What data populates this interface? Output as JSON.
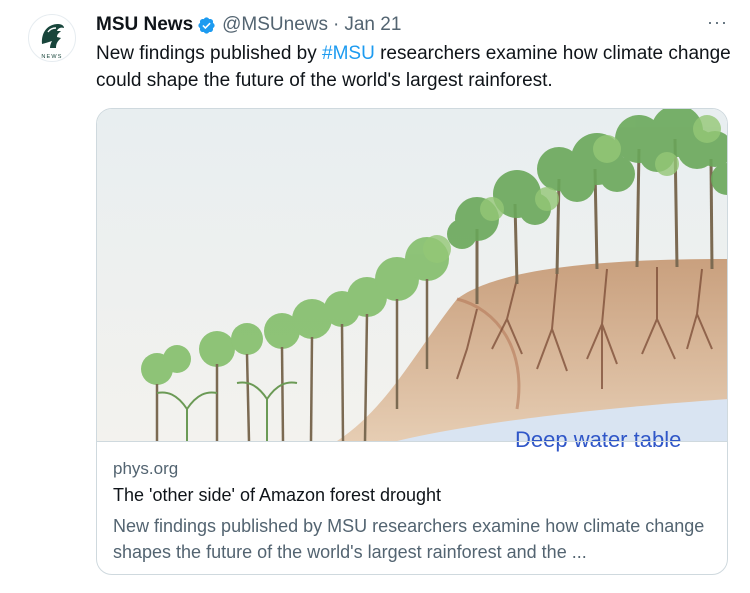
{
  "tweet": {
    "author_name": "MSU News",
    "avatar_text": "NEWS",
    "handle": "@MSUnews",
    "separator": "·",
    "date": "Jan 21",
    "more_label": "···",
    "text_before": "New findings published by ",
    "hashtag": "#MSU",
    "text_after": " researchers examine how climate change could shape the future of the world's largest rainforest."
  },
  "card": {
    "image_label": "Deep water table",
    "domain": "phys.org",
    "title": "The 'other side' of Amazon forest drought",
    "description": "New findings published by MSU researchers examine how climate change shapes the future of the world's largest rainforest and the ..."
  },
  "colors": {
    "link": "#1d9bf0",
    "verified": "#1d9bf0",
    "msu_green": "#18453b",
    "secondary_text": "#536471"
  },
  "icons": {
    "avatar": "spartan-helmet-icon",
    "verified": "verified-badge-icon",
    "more": "more-options-icon"
  }
}
